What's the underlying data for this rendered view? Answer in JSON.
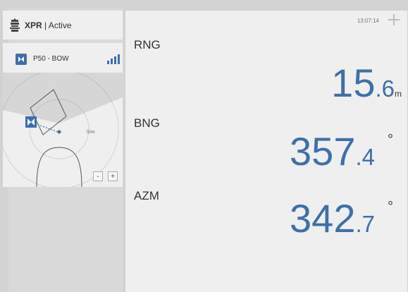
{
  "header": {
    "app_name": "XPR",
    "status": " | Active",
    "clock": "13:07:14"
  },
  "vessel": {
    "name": "P50 - BOW",
    "radar_range_label": "50m"
  },
  "zoom": {
    "minus": "-",
    "plus": "+"
  },
  "readings": [
    {
      "label": "RNG",
      "integer": "15",
      "decimal": ".6",
      "unit": "m"
    },
    {
      "label": "BNG",
      "integer": "357",
      "decimal": ".4",
      "unit": "°"
    },
    {
      "label": "AZM",
      "integer": "342",
      "decimal": ".7",
      "unit": "°"
    }
  ],
  "colors": {
    "accent": "#3f6fa7",
    "panel": "#efefef",
    "background": "#d2d2d2"
  },
  "icons": [
    "crest-icon",
    "vessel-icon",
    "signal-strength-icon",
    "add-icon"
  ]
}
